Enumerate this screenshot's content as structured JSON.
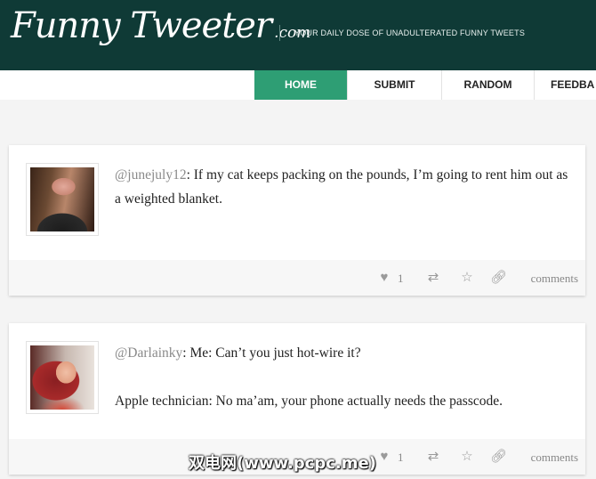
{
  "header": {
    "logo_main": "Funny Tweeter",
    "logo_suffix": ".com",
    "tagline": "YOUR DAILY DOSE OF UNADULTERATED FUNNY TWEETS"
  },
  "nav": {
    "items": [
      {
        "label": "HOME",
        "active": true
      },
      {
        "label": "SUBMIT"
      },
      {
        "label": "RANDOM"
      },
      {
        "label": "FEEDBA"
      }
    ]
  },
  "tweets": [
    {
      "handle": "@junejuly12",
      "text": ": If my cat keeps packing on the pounds, I’m going to rent him out as a weighted blanket.",
      "likes": "1",
      "comments_label": "comments"
    },
    {
      "handle": "@Darlainky",
      "text": ": Me: Can’t you just hot-wire it?",
      "text2": "Apple technician: No ma’am, your phone actually needs the passcode.",
      "likes": "1",
      "comments_label": "comments"
    }
  ],
  "watermark": "双电网(www.pcpc.me)",
  "colors": {
    "header_bg": "#0f3a36",
    "nav_active": "#2e9e74",
    "handle": "#8a8a8a"
  },
  "icons": [
    "heart-icon",
    "retweet-icon",
    "star-icon",
    "link-icon"
  ]
}
